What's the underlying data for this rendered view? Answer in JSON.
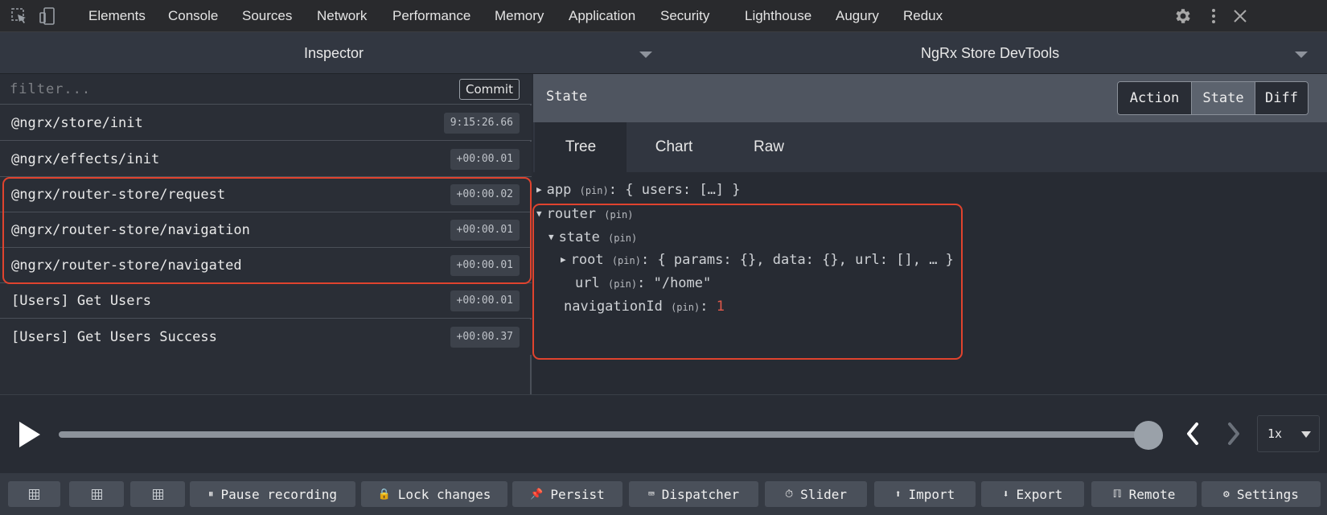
{
  "devtools": {
    "tabs": [
      "Elements",
      "Console",
      "Sources",
      "Network",
      "Performance",
      "Memory",
      "Application",
      "Security",
      "Lighthouse",
      "Augury",
      "Redux"
    ],
    "icons": [
      "inspect-element-icon",
      "device-toolbar-icon",
      "gear-icon",
      "more-icon",
      "close-icon"
    ]
  },
  "panels": {
    "left_title": "Inspector",
    "right_title": "NgRx Store DevTools"
  },
  "inspector": {
    "filter_placeholder": "filter...",
    "commit_label": "Commit",
    "actions": [
      {
        "name": "@ngrx/store/init",
        "time": "9:15:26.66"
      },
      {
        "name": "@ngrx/effects/init",
        "time": "+00:00.01"
      },
      {
        "name": "@ngrx/router-store/request",
        "time": "+00:00.02"
      },
      {
        "name": "@ngrx/router-store/navigation",
        "time": "+00:00.01"
      },
      {
        "name": "@ngrx/router-store/navigated",
        "time": "+00:00.01"
      },
      {
        "name": "[Users] Get Users",
        "time": "+00:00.01"
      },
      {
        "name": "[Users] Get Users Success",
        "time": "+00:00.37"
      }
    ]
  },
  "state_panel": {
    "title": "State",
    "modes": [
      "Action",
      "State",
      "Diff"
    ],
    "active_mode": "State",
    "view_tabs": [
      "Tree",
      "Chart",
      "Raw"
    ],
    "active_view": "Tree",
    "tree": {
      "app_key": "app",
      "app_value": "{ users: […] }",
      "router_key": "router",
      "state_key": "state",
      "root_key": "root",
      "root_value": "{ params: {}, data: {}, url: [], … }",
      "url_key": "url",
      "url_value": "\"/home\"",
      "navigation_key": "navigationId",
      "navigation_value": "1",
      "pin_label": "(pin)",
      "colon": ":"
    }
  },
  "playback": {
    "speed": "1x",
    "progress": 1.0
  },
  "toolbar": {
    "pause_recording": "Pause recording",
    "lock_changes": "Lock changes",
    "persist": "Persist",
    "dispatcher": "Dispatcher",
    "slider": "Slider",
    "import": "Import",
    "export": "Export",
    "remote": "Remote",
    "settings": "Settings"
  },
  "colors": {
    "highlight": "#e0432e",
    "number": "#e0584a"
  }
}
